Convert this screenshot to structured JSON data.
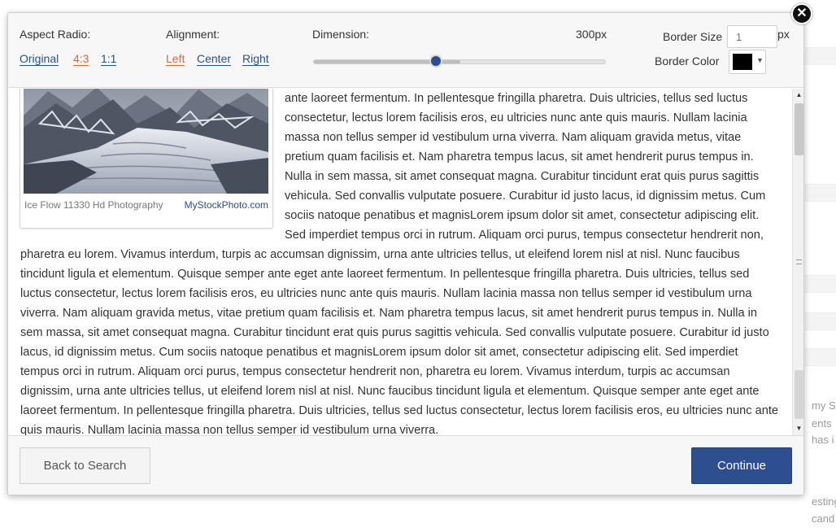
{
  "toolbar": {
    "aspect_label": "Aspect Radio:",
    "aspect_options": [
      "Original",
      "4:3",
      "1:1"
    ],
    "aspect_selected": "4:3",
    "alignment_label": "Alignment:",
    "alignment_options": [
      "Left",
      "Center",
      "Right"
    ],
    "alignment_selected": "Left",
    "dimension_label": "Dimension:",
    "dimension_value": "300px",
    "dimension_slider_fraction": 0.42,
    "border_size_label": "Border Size",
    "border_size_placeholder": "1",
    "border_size_unit": "px",
    "border_color_label": "Border Color",
    "border_color_value": "#000000"
  },
  "figure": {
    "caption_title": "Ice Flow 11330 Hd Photography",
    "caption_source": "MyStockPhoto.com"
  },
  "article": {
    "text": "ante laoreet fermentum. In pellentesque fringilla pharetra. Duis ultricies, tellus sed luctus consectetur, lectus lorem facilisis eros, eu ultricies nunc ante quis mauris. Nullam lacinia massa non tellus semper id vestibulum urna viverra. Nam aliquam gravida metus, vitae pretium quam facilisis et. Nam pharetra tempus lacus, sit amet hendrerit purus tempus in. Nulla in sem massa, sit amet consequat magna. Curabitur tincidunt erat quis purus sagittis vehicula. Sed convallis vulputate posuere. Curabitur id justo lacus, id dignissim metus. Cum sociis natoque penatibus et magnisLorem ipsum dolor sit amet, consectetur adipiscing elit. Sed imperdiet tempus orci in rutrum. Aliquam orci purus, tempus consectetur hendrerit non, pharetra eu lorem. Vivamus interdum, turpis ac accumsan dignissim, urna ante ultricies tellus, ut eleifend lorem nisl at nisl. Nunc faucibus tincidunt ligula et elementum. Quisque semper ante eget ante laoreet fermentum. In pellentesque fringilla pharetra. Duis ultricies, tellus sed luctus consectetur, lectus lorem facilisis eros, eu ultricies nunc ante quis mauris. Nullam lacinia massa non tellus semper id vestibulum urna viverra. Nam aliquam gravida metus, vitae pretium quam facilisis et. Nam pharetra tempus lacus, sit amet hendrerit purus tempus in. Nulla in sem massa, sit amet consequat magna. Curabitur tincidunt erat quis purus sagittis vehicula. Sed convallis vulputate posuere. Curabitur id justo lacus, id dignissim metus. Cum sociis natoque penatibus et magnisLorem ipsum dolor sit amet, consectetur adipiscing elit. Sed imperdiet tempus orci in rutrum. Aliquam orci purus, tempus consectetur hendrerit non, pharetra eu lorem. Vivamus interdum, turpis ac accumsan dignissim, urna ante ultricies tellus, ut eleifend lorem nisl at nisl. Nunc faucibus tincidunt ligula et elementum. Quisque semper ante eget ante laoreet fermentum. In pellentesque fringilla pharetra. Duis ultricies, tellus sed luctus consectetur, lectus lorem facilisis eros, eu ultricies nunc ante quis mauris. Nullam lacinia massa non tellus semper id vestibulum urna viverra."
  },
  "footer": {
    "back_label": "Back to Search",
    "continue_label": "Continue"
  },
  "background_page": {
    "snippets": [
      "my S",
      "ents",
      "has i",
      "esting",
      "cand"
    ]
  },
  "icons": {
    "close": "close-icon",
    "scroll_up": "scroll-up-arrow-icon",
    "scroll_down": "scroll-down-arrow-icon",
    "color_caret": "chevron-down-icon"
  },
  "colors": {
    "accent_active": "#d86a3a",
    "link": "#2b4f8e",
    "primary_button": "#2d4f8f"
  }
}
